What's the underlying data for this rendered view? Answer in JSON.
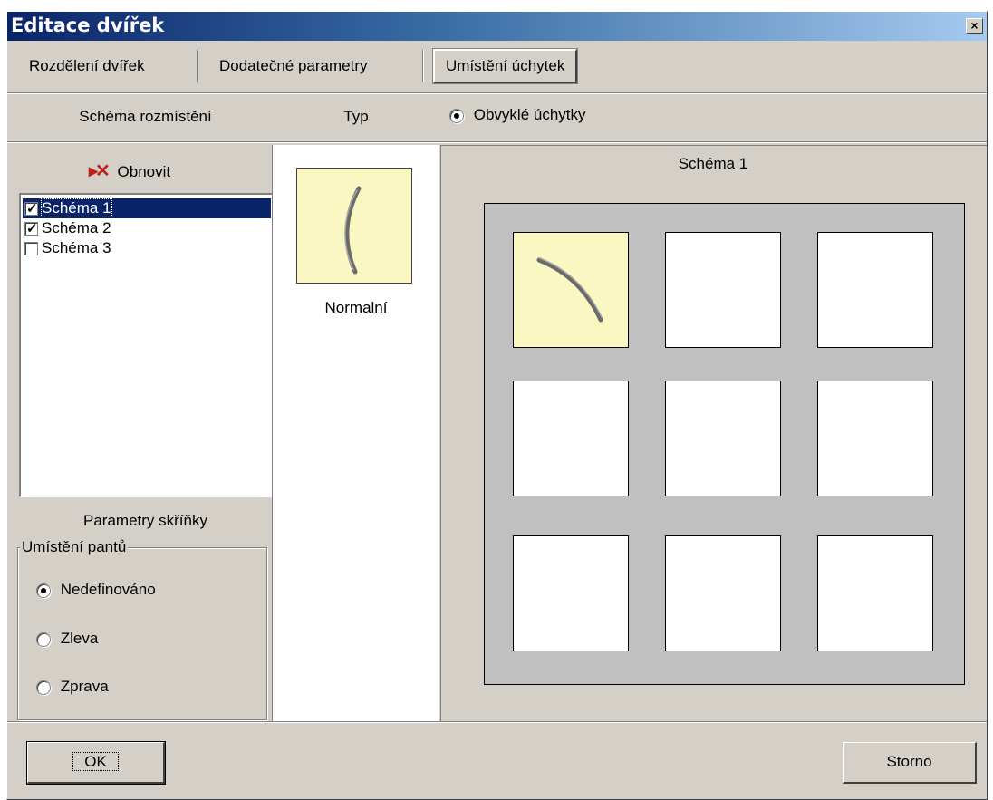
{
  "window": {
    "title": "Editace dvířek",
    "close_glyph": "×"
  },
  "tabs": [
    {
      "label": "Rozdělení dvířek",
      "active": false
    },
    {
      "label": "Dodatečné parametry",
      "active": false
    },
    {
      "label": "Umístění úchytek",
      "active": true
    }
  ],
  "headers": {
    "scheme_layout": "Schéma rozmístění",
    "type": "Typ",
    "handle_radio_label": "Obvyklé úchytky"
  },
  "left_panel": {
    "refresh_label": "Obnovit",
    "refresh_icon": "red-x-refresh-icon",
    "schemes": [
      {
        "label": "Schéma 1",
        "checked": true,
        "selected": true
      },
      {
        "label": "Schéma 2",
        "checked": true,
        "selected": false
      },
      {
        "label": "Schéma 3",
        "checked": false,
        "selected": false
      }
    ]
  },
  "cabinet_params": {
    "title": "Parametry skříňky",
    "hinge_group_title": "Umístění pantů",
    "options": [
      {
        "label": "Nedefinováno",
        "checked": true
      },
      {
        "label": "Zleva",
        "checked": false
      },
      {
        "label": "Zprava",
        "checked": false
      }
    ]
  },
  "type_panel": {
    "handle_name": "Normalní",
    "handle_icon": "curved-handle-icon"
  },
  "scheme_view": {
    "title": "Schéma 1",
    "grid_rows": 3,
    "grid_cols": 3,
    "filled_cell": 0
  },
  "footer": {
    "ok_label": "OK",
    "cancel_label": "Storno"
  },
  "colors": {
    "dialog_bg": "#d4d0c8",
    "title_gradient_start": "#0a246a",
    "selection": "#0a246a",
    "handle_bg": "#fbf7c2",
    "grid_bg": "#c0c0c0"
  }
}
